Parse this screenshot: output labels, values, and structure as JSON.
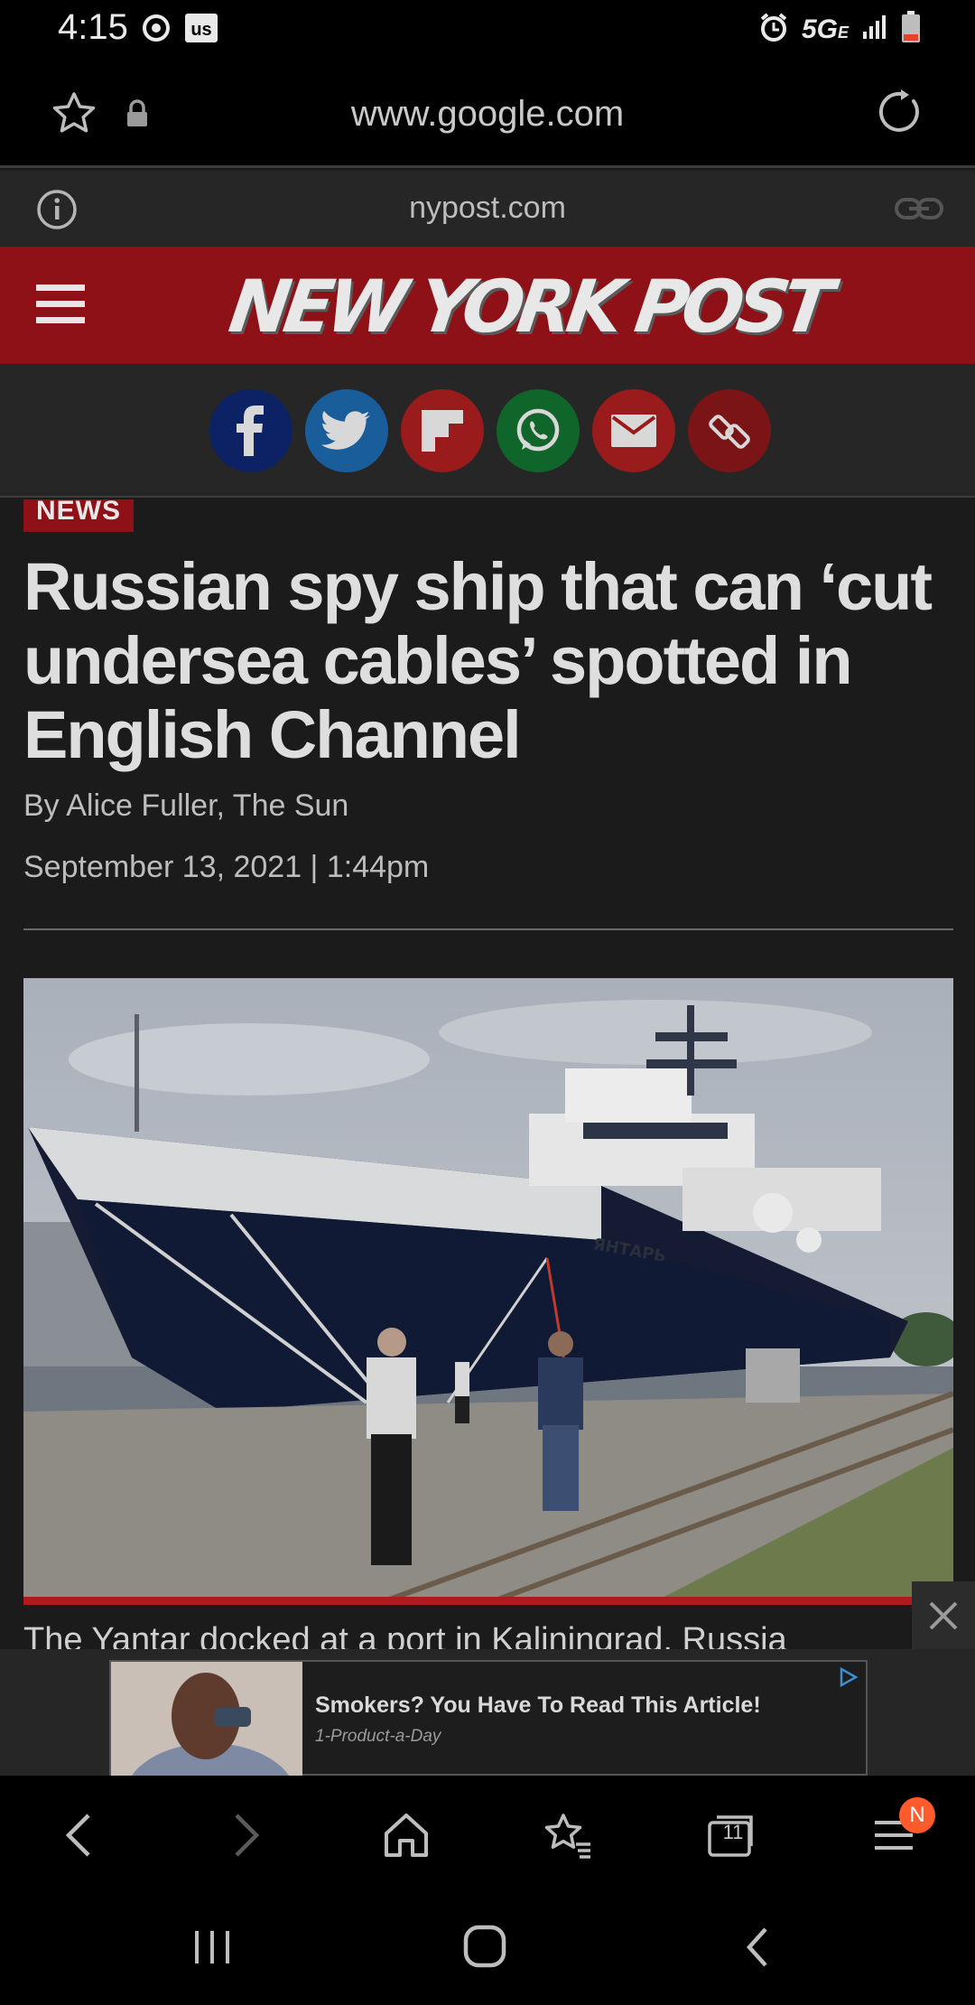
{
  "status_bar": {
    "time": "4:15",
    "network": "5G",
    "network_suffix": "E",
    "icons": [
      "sync-icon",
      "us-app-icon",
      "alarm-icon",
      "signal-icon",
      "battery-icon"
    ]
  },
  "browser": {
    "url": "www.google.com",
    "domain": "nypost.com",
    "toolbar": {
      "tab_count": "11",
      "notification_badge": "N",
      "buttons": [
        "back-icon",
        "forward-icon",
        "home-icon",
        "bookmarks-icon",
        "tabs-icon",
        "menu-icon"
      ]
    }
  },
  "site": {
    "logo_text": "NEW YORK POST",
    "brand_color": "#8e1117",
    "share_buttons": [
      "facebook-icon",
      "twitter-icon",
      "flipboard-icon",
      "whatsapp-icon",
      "email-icon",
      "link-icon"
    ]
  },
  "article": {
    "section": "NEWS",
    "headline": "Russian spy ship that can ‘cut undersea cables’ spotted in English Channel",
    "byline": "By Alice Fuller, The Sun",
    "date": "September 13, 2021 | 1:44pm",
    "photo_caption": "The Yantar docked at a port in Kaliningrad, Russia",
    "ship_name": "ЯНТАРЬ"
  },
  "ad": {
    "title": "Smokers? You Have To Read This Article!",
    "sponsor": "1-Product-a-Day"
  }
}
